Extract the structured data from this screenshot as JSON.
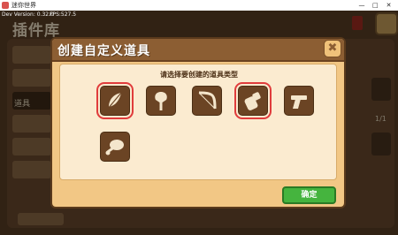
{
  "window": {
    "title": "迷你世界",
    "minimize": "—",
    "maximize": "□",
    "close": "✕"
  },
  "debug": {
    "version": "Dev Version: 0.32.0",
    "fps": "FPS:527.5"
  },
  "background": {
    "title": "插件库",
    "tab_label": "道具",
    "page_indicator": "1/1"
  },
  "dialog": {
    "title": "创建自定义道具",
    "prompt": "请选择要创建的道具类型",
    "confirm_label": "确定",
    "close_icon": "✖",
    "item_types": [
      {
        "icon": "feather-icon",
        "highlighted": true
      },
      {
        "icon": "shovel-icon",
        "highlighted": false
      },
      {
        "icon": "bow-icon",
        "highlighted": false
      },
      {
        "icon": "bandage-icon",
        "highlighted": true
      },
      {
        "icon": "revolver-icon",
        "highlighted": false
      },
      {
        "icon": "meat-icon",
        "highlighted": false
      }
    ]
  },
  "colors": {
    "dialog_bg": "#f2c785",
    "header": "#8c5e33",
    "highlight": "#e03c3c",
    "confirm": "#45b43e"
  }
}
